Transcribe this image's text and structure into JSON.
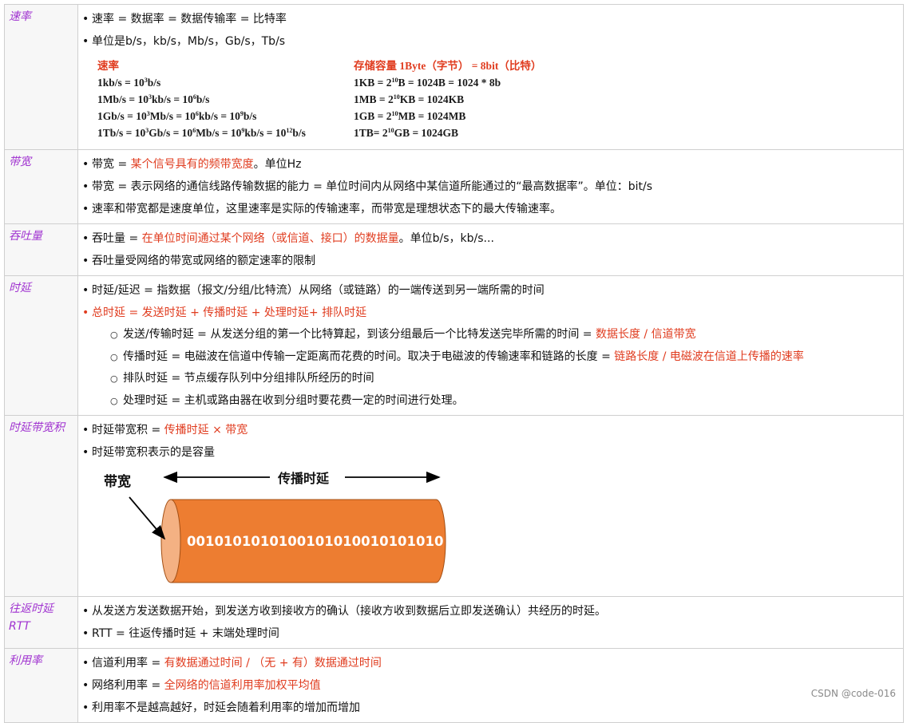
{
  "rows": {
    "rate": {
      "label": "速率",
      "b1": "速率 = 数据率 = 数据传输率 = 比特率",
      "b2": "单位是b/s，kb/s，Mb/s，Gb/s，Tb/s",
      "left_header": "速率",
      "left_lines": [
        [
          "1kb/s  = 10",
          "3",
          "b/s"
        ],
        [
          "1Mb/s = 10",
          "3",
          "kb/s = 10",
          "6",
          "b/s"
        ],
        [
          "1Gb/s = 10",
          "3",
          "Mb/s = 10",
          "6",
          "kb/s = 10",
          "9",
          "b/s"
        ],
        [
          "1Tb/s = 10",
          "3",
          "Gb/s = 10",
          "6",
          "Mb/s = 10",
          "9",
          "kb/s = 10",
          "12",
          "b/s"
        ]
      ],
      "right_header": "存储容量 1Byte（字节） = 8bit（比特）",
      "right_lines": [
        [
          "1KB  = 2",
          "10",
          "B = 1024B = 1024 * 8b"
        ],
        [
          "1MB = 2",
          "10",
          "KB = 1024KB"
        ],
        [
          "1GB = 2",
          "10",
          "MB = 1024MB"
        ],
        [
          "1TB= 2",
          "10",
          "GB = 1024GB"
        ]
      ]
    },
    "bandwidth": {
      "label": "带宽",
      "b1_pre": "带宽 = ",
      "b1_red": "某个信号具有的频带宽度",
      "b1_post": "。单位Hz",
      "b2": "带宽 = 表示网络的通信线路传输数据的能力 = 单位时间内从网络中某信道所能通过的“最高数据率”。单位：bit/s",
      "b3": "速率和带宽都是速度单位，这里速率是实际的传输速率，而带宽是理想状态下的最大传输速率。"
    },
    "throughput": {
      "label": "吞吐量",
      "b1_pre": "吞吐量 = ",
      "b1_red": "在单位时间通过某个网络（或信道、接口）的数据量",
      "b1_post": "。单位b/s，kb/s...",
      "b2": "吞吐量受网络的带宽或网络的额定速率的限制"
    },
    "delay": {
      "label": "时延",
      "b1": "时延/延迟 = 指数据（报文/分组/比特流）从网络（或链路）的一端传送到另一端所需的时间",
      "b2": "总时延 = 发送时延 + 传播时延 + 处理时延+ 排队时延",
      "s1_pre": "发送/传输时延 = 从发送分组的第一个比特算起，到该分组最后一个比特发送完毕所需的时间 = ",
      "s1_red": "数据长度 / 信道带宽",
      "s2_pre": "传播时延 = 电磁波在信道中传输一定距离而花费的时间。取决于电磁波的传输速率和链路的长度 = ",
      "s2_red": "链路长度 / 电磁波在信道上传播的速率",
      "s3": "排队时延 = 节点缓存队列中分组排队所经历的时间",
      "s4": "处理时延 = 主机或路由器在收到分组时要花费一定的时间进行处理。"
    },
    "dbp": {
      "label": "时延带宽积",
      "b1_pre": "时延带宽积 = ",
      "b1_red": "传播时延 × 带宽",
      "b2": "时延带宽积表示的是容量",
      "fig_bandwidth": "带宽",
      "fig_delay": "传播时延",
      "fig_bits": "0010101010100101010010101010 1"
    },
    "rtt": {
      "label": "往返时延RTT",
      "b1": "从发送方发送数据开始，到发送方收到接收方的确认（接收方收到数据后立即发送确认）共经历的时延。",
      "b2": "RTT = 往返传播时延 + 末端处理时间"
    },
    "util": {
      "label": "利用率",
      "b1_pre": "信道利用率 = ",
      "b1_red": "有数据通过时间 / （无 + 有）数据通过时间",
      "b2_pre": "网络利用率 = ",
      "b2_red": "全网络的信道利用率加权平均值",
      "b3": "利用率不是越高越好，时延会随着利用率的增加而增加"
    }
  },
  "watermark": "CSDN @code-016",
  "colors": {
    "accent_red": "#e03c1f",
    "label_purple": "#a033d0",
    "cylinder": "#ed7d31",
    "cylinder_end": "#f4b183"
  }
}
